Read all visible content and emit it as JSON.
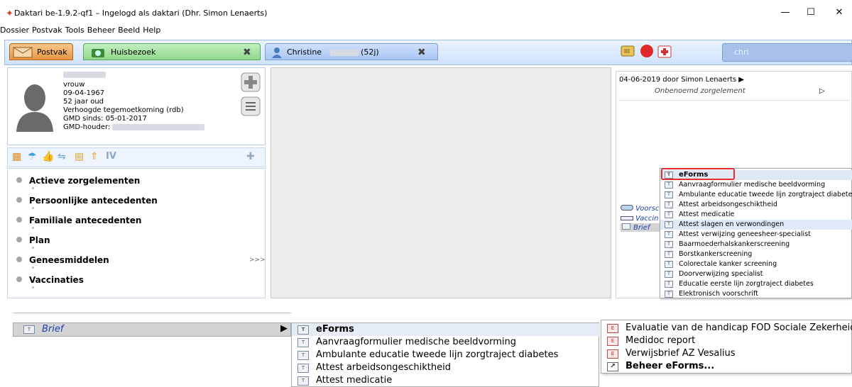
{
  "window": {
    "title": "Daktari be-1.9.2-qf1 – Ingelogd als daktari (Dhr. Simon Lenaerts)",
    "minimize": "—",
    "maximize": "☐",
    "close": "✕"
  },
  "menubar": [
    "Dossier",
    "Postvak",
    "Tools",
    "Beheer",
    "Beeld",
    "Help"
  ],
  "tabs": {
    "postvak": "Postvak",
    "huisbezoek": "Huisbezoek",
    "christine": "Christine",
    "christine_age": "(52j)",
    "close": "✖"
  },
  "search": {
    "value": "chri"
  },
  "patient": {
    "gender": "vrouw",
    "birthdate": "09-04-1967",
    "age": "52 jaar oud",
    "status": "Verhoogde tegemoetkoming (rdb)",
    "gmd_since_label": "GMD sinds:",
    "gmd_since": "05-01-2017",
    "gmd_holder_label": "GMD-houder:"
  },
  "sections": [
    "Actieve zorgelementen",
    "Persoonlijke antecedenten",
    "Familiale antecedenten",
    "Plan",
    "Geneesmiddelen",
    "Vaccinaties"
  ],
  "more_marker": ">>>",
  "iv_label": "IV",
  "right_panel": {
    "header": "04-06-2019 door  Simon Lenaerts ▶",
    "unnamed": "Onbenoemd zorgelement",
    "arrow": "▷",
    "items": [
      "Voorsc",
      "Vaccin",
      "Brief"
    ]
  },
  "menu_top": {
    "header": "eForms",
    "items": [
      "Aanvraagformulier medische beeldvorming",
      "Ambulante educatie tweede lijn zorgtraject diabetes",
      "Attest arbeidsongeschiktheid",
      "Attest medicatie",
      "Attest slagen en verwondingen",
      "Attest verwijzing geneesheer-specialist",
      "Baarmoederhalskankerscreening",
      "Borstkankerscreening",
      "Colorectale kanker screening",
      "Doorverwijzing specialist",
      "Educatie eerste lijn zorgtraject diabetes",
      "Elektronisch voorschrift"
    ]
  },
  "zoom": {
    "brief": "Brief",
    "arrow": "▶",
    "menu1": {
      "header": "eForms",
      "items": [
        "Aanvraagformulier medische beeldvorming",
        "Ambulante educatie tweede lijn zorgtraject diabetes",
        "Attest arbeidsongeschiktheid",
        "Attest medicatie"
      ]
    },
    "menu2": {
      "items": [
        "Evaluatie van de handicap FOD Sociale Zekerheid",
        "Medidoc report",
        "Verwijsbrief AZ Vesalius"
      ],
      "manage": "Beheer eForms..."
    }
  },
  "colors": {
    "accent_red": "#e03030",
    "postvak_tab": "#e8963f",
    "huisbezoek_tab": "#8fd889",
    "christine_tab": "#a9c6f3",
    "link_blue": "#1f3fae"
  }
}
